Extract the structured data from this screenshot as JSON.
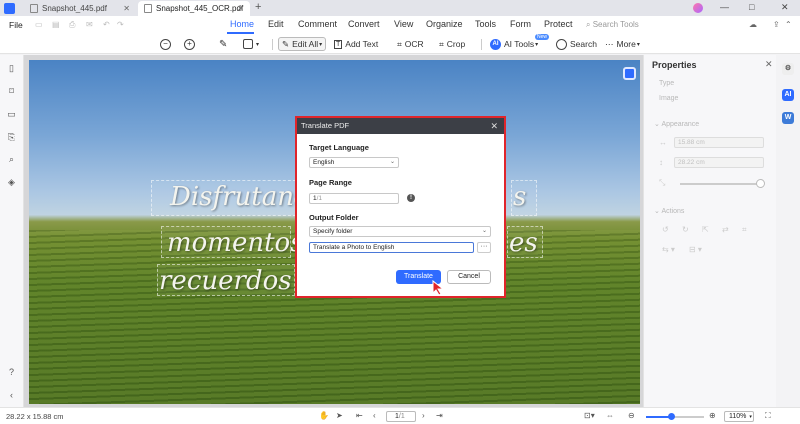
{
  "titlebar": {
    "tabs": [
      {
        "label": "Snapshot_445.pdf",
        "active": false
      },
      {
        "label": "Snapshot_445_OCR.pdf",
        "active": true
      }
    ],
    "new_tab": "+",
    "controls": [
      "—",
      "□",
      "✕"
    ]
  },
  "menubar": {
    "file_label": "File",
    "items": [
      "Home",
      "Edit",
      "Comment",
      "Convert",
      "View",
      "Organize",
      "Tools",
      "Form",
      "Protect"
    ],
    "active_item": "Home",
    "search_tools_placeholder": "Search Tools"
  },
  "toolbar": {
    "edit_all": "Edit All",
    "add_text": "Add Text",
    "ocr": "OCR",
    "crop": "Crop",
    "ai_tools": "AI Tools",
    "ai_badge": "New",
    "search": "Search",
    "more": "More"
  },
  "document": {
    "lines": [
      "Disfrutand",
      "momentos",
      "recuerdos ."
    ],
    "ghost_fragments": [
      "s",
      "es"
    ]
  },
  "properties": {
    "title": "Properties",
    "type_label": "Type",
    "type_value": "Image",
    "appearance_label": "Appearance",
    "width_value": "15.88 cm",
    "height_value": "28.22 cm",
    "actions_label": "Actions"
  },
  "dialog": {
    "title": "Translate PDF",
    "target_language_label": "Target Language",
    "target_language_value": "English",
    "page_range_label": "Page Range",
    "page_range_value": "1",
    "page_range_total": "/1",
    "output_folder_label": "Output Folder",
    "output_folder_value": "Specify folder",
    "file_name_value": "Translate a Photo to English",
    "browse_label": "···",
    "translate_button": "Translate",
    "cancel_button": "Cancel"
  },
  "statusbar": {
    "dimensions": "28.22 x 15.88 cm",
    "page_current": "1",
    "page_total": "/1",
    "zoom": "110%",
    "zoom_fraction": 0.44
  },
  "colors": {
    "accent": "#2f6bff",
    "highlight_outline": "#e0252b",
    "dialog_header": "#3c3f46"
  }
}
